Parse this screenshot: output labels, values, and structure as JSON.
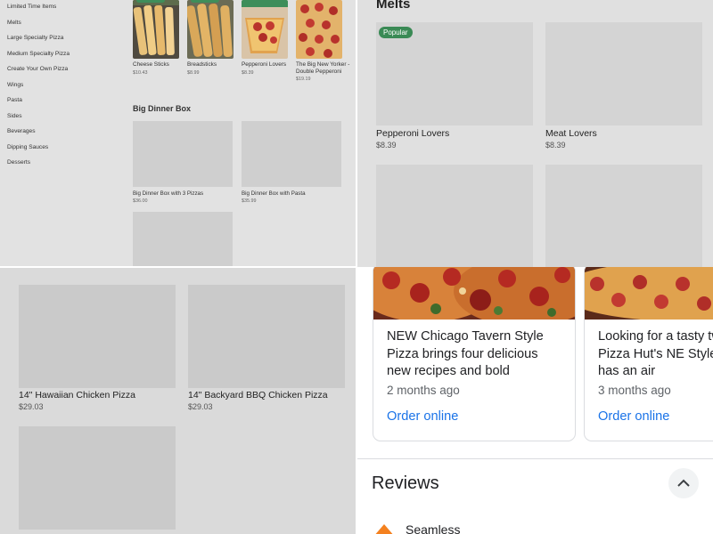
{
  "menu": {
    "sidebar": [
      "Limited Time Items",
      "Melts",
      "Large Specialty Pizza",
      "Medium Specialty Pizza",
      "Create Your Own Pizza",
      "Wings",
      "Pasta",
      "Sides",
      "Beverages",
      "Dipping Sauces",
      "Desserts"
    ],
    "top_items": [
      {
        "name": "Cheese Sticks",
        "price": "$10.43"
      },
      {
        "name": "Breadsticks",
        "price": "$8.99"
      },
      {
        "name": "Pepperoni Lovers",
        "price": "$8.39"
      },
      {
        "name": "The Big New Yorker - Double Pepperoni",
        "price": "$19.19"
      }
    ],
    "big_dinner_title": "Big Dinner Box",
    "big_dinner_items": [
      {
        "name": "Big Dinner Box with 3 Pizzas",
        "price": "$36.00"
      },
      {
        "name": "Big Dinner Box with Pasta",
        "price": "$35.99"
      }
    ]
  },
  "melts": {
    "title": "Melts",
    "badge": "Popular",
    "items": [
      {
        "name": "Pepperoni Lovers",
        "price": "$8.39"
      },
      {
        "name": "Meat Lovers",
        "price": "$8.39"
      }
    ]
  },
  "pizzas": {
    "items": [
      {
        "name": "14\" Hawaiian Chicken Pizza",
        "price": "$29.03"
      },
      {
        "name": "14\" Backyard BBQ Chicken Pizza",
        "price": "$29.03"
      }
    ]
  },
  "posts": [
    {
      "text": "NEW Chicago Tavern Style Pizza brings four delicious new recipes and bold ingredients …",
      "ago": "2 months ago",
      "link": "Order online"
    },
    {
      "text": "Looking for a tasty tw crust? Pizza Hut's NE Style Pizza has an air",
      "ago": "3 months ago",
      "link": "Order online"
    }
  ],
  "reviews": {
    "title": "Reviews",
    "source": "Seamless"
  },
  "colors": {
    "badge_green": "#3a8a55",
    "link_blue": "#1a73e8"
  }
}
